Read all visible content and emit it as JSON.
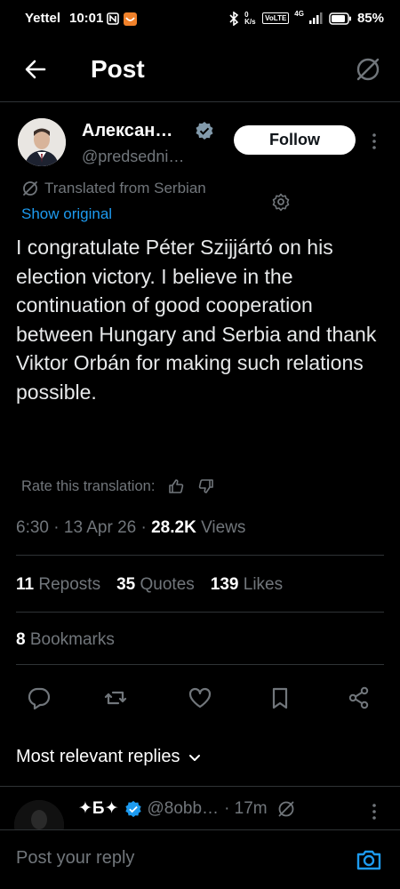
{
  "status_bar": {
    "carrier": "Yettel",
    "time": "10:01",
    "speed": "0 K/s",
    "volte": "VoLTE",
    "network": "4G",
    "battery": "85%"
  },
  "header": {
    "title": "Post"
  },
  "post": {
    "author_name": "Алексан…",
    "handle": "@predsedni…",
    "follow_label": "Follow",
    "translated_from": "Translated from Serbian",
    "show_original": "Show original",
    "text": "I congratulate Péter Szijjártó on his election victory. I believe in the continuation of good cooperation between Hungary and Serbia and thank Viktor Orbán for making such relations possible.",
    "rate_translation": "Rate this translation:",
    "time": "6:30",
    "date": "13 Apr 26",
    "views_count": "28.2K",
    "views_label": "Views",
    "reposts_count": "11",
    "reposts_label": "Reposts",
    "quotes_count": "35",
    "quotes_label": "Quotes",
    "likes_count": "139",
    "likes_label": "Likes",
    "bookmarks_count": "8",
    "bookmarks_label": "Bookmarks"
  },
  "replies": {
    "sort_label": "Most relevant replies",
    "first": {
      "name": "✦Б✦",
      "handle": "@8obb…",
      "age": "· 17m"
    }
  },
  "compose": {
    "placeholder": "Post your reply"
  },
  "colors": {
    "background": "#000000",
    "text": "#e7e9ea",
    "muted": "#71767b",
    "accent": "#1d9bf0",
    "divider": "#2f3336"
  },
  "icons": [
    "back-arrow-icon",
    "translate-icon",
    "verified-badge-icon",
    "more-vertical-icon",
    "gear-icon",
    "thumbs-up-icon",
    "thumbs-down-icon",
    "reply-icon",
    "repost-icon",
    "like-icon",
    "bookmark-icon",
    "share-icon",
    "chevron-down-icon",
    "camera-icon"
  ]
}
